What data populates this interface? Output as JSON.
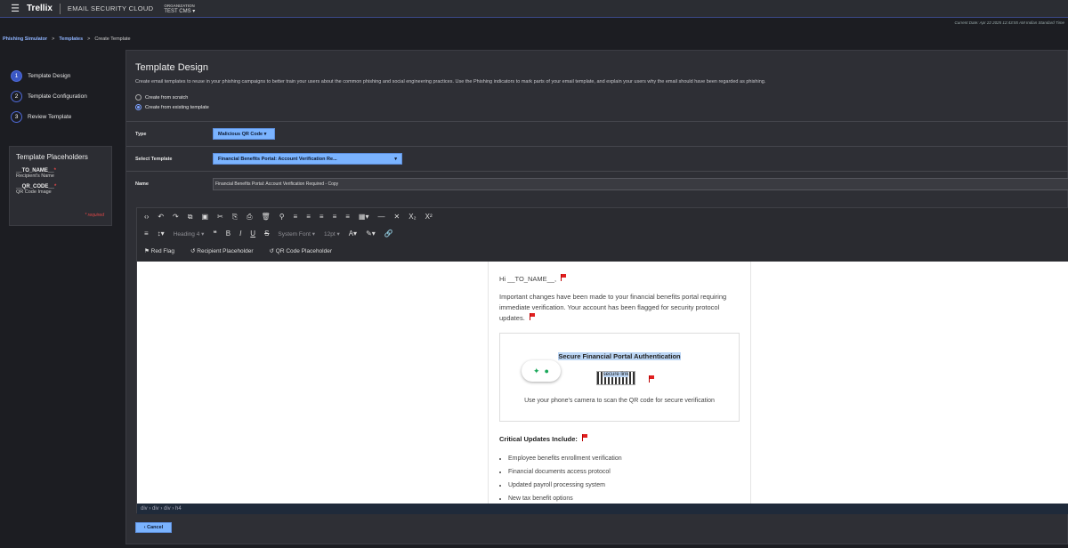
{
  "topbar": {
    "brand": "Trellix",
    "product": "EMAIL SECURITY CLOUD",
    "org_label": "ORGANIZATION",
    "org_value": "TEST CMS ▾"
  },
  "date_note": "Current Date: Apr 22 2025 12:43:55 AM Indian Standard Time",
  "breadcrumb": [
    "Phishing Simulator",
    "Templates",
    "Create Template"
  ],
  "steps": [
    {
      "num": "1",
      "label": "Template Design"
    },
    {
      "num": "2",
      "label": "Template Configuration"
    },
    {
      "num": "3",
      "label": "Review Template"
    }
  ],
  "placeholders": {
    "title": "Template Placeholders",
    "items": [
      {
        "token": "__TO_NAME__",
        "desc": "Recipient's Name"
      },
      {
        "token": "__QR_CODE__",
        "desc": "QR Code Image"
      }
    ],
    "required_note": "* required"
  },
  "page": {
    "title": "Template Design",
    "intro": "Create email templates to reuse in your phishing campaigns to better train your users about the common phishing and social engineering practices. Use the Phishing indicators to mark parts of your email template, and explain your users why the email should have been regarded as phishing.",
    "radio_scratch": "Create from scratch",
    "radio_existing": "Create from existing template"
  },
  "form": {
    "type_label": "Type",
    "type_value": "Malicious QR Code ▾",
    "template_label": "Select Template",
    "template_value": "Financial Benefits Portal: Account Verification Re...",
    "name_label": "Name",
    "name_value": "Financial Benefits Portal: Account Verification Required - Copy"
  },
  "toolbar": {
    "heading": "Heading 4",
    "font": "System Font",
    "size": "12pt",
    "red_flag": "Red Flag",
    "recipient": "Recipient Placeholder",
    "qr": "QR Code Placeholder"
  },
  "email": {
    "greeting": "Hi __TO_NAME__,",
    "para": "Important changes have been made to your financial benefits portal requiring immediate verification. Your account has been flagged for security protocol updates.",
    "card_title": "Secure Financial Portal Authentication",
    "qr_label": "secure link",
    "caption": "Use your phone's camera to scan the QR code for secure verification",
    "section_heading": "Critical Updates Include:",
    "list": [
      "Employee benefits enrollment verification",
      "Financial documents access protocol",
      "Updated payroll processing system",
      "New tax benefit options"
    ]
  },
  "status_path": "div › div › div › h4",
  "cancel_label": "‹ Cancel"
}
